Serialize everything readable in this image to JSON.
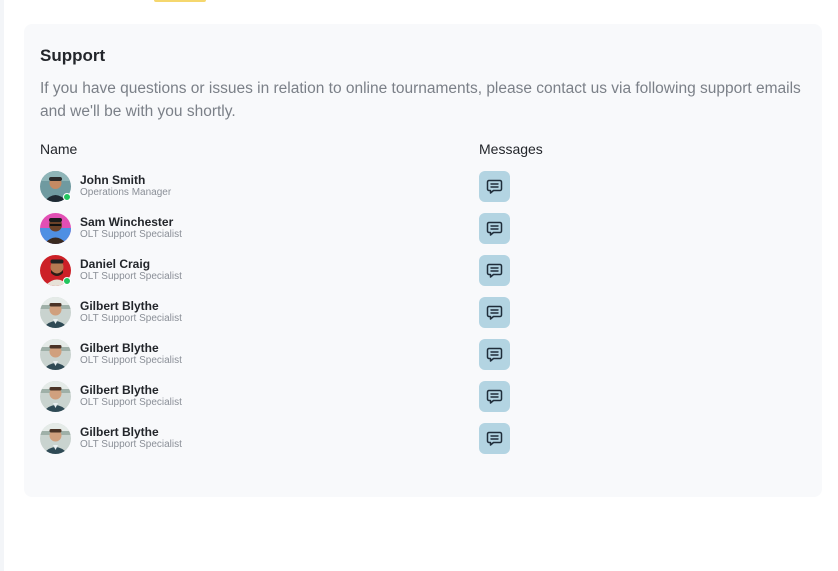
{
  "support": {
    "title": "Support",
    "description": "If you have questions or issues in relation to online tournaments, please contact us via following support emails and we'll be with you shortly.",
    "columns": {
      "name": "Name",
      "messages": "Messages"
    },
    "contacts": [
      {
        "name": "John Smith",
        "role": "Operations Manager",
        "online": true,
        "avatar": "person-a"
      },
      {
        "name": "Sam Winchester",
        "role": "OLT Support Specialist",
        "online": false,
        "avatar": "person-b"
      },
      {
        "name": "Daniel Craig",
        "role": "OLT Support Specialist",
        "online": true,
        "avatar": "person-c"
      },
      {
        "name": "Gilbert Blythe",
        "role": "OLT Support Specialist",
        "online": false,
        "avatar": "person-d"
      },
      {
        "name": "Gilbert Blythe",
        "role": "OLT Support Specialist",
        "online": false,
        "avatar": "person-d"
      },
      {
        "name": "Gilbert Blythe",
        "role": "OLT Support Specialist",
        "online": false,
        "avatar": "person-d"
      },
      {
        "name": "Gilbert Blythe",
        "role": "OLT Support Specialist",
        "online": false,
        "avatar": "person-d"
      }
    ],
    "message_icon": "message-icon"
  },
  "colors": {
    "card_bg": "#f8f9fb",
    "message_button_bg": "#b3d4e2",
    "online_indicator": "#22c55e",
    "accent_tab": "#f5d76e"
  }
}
